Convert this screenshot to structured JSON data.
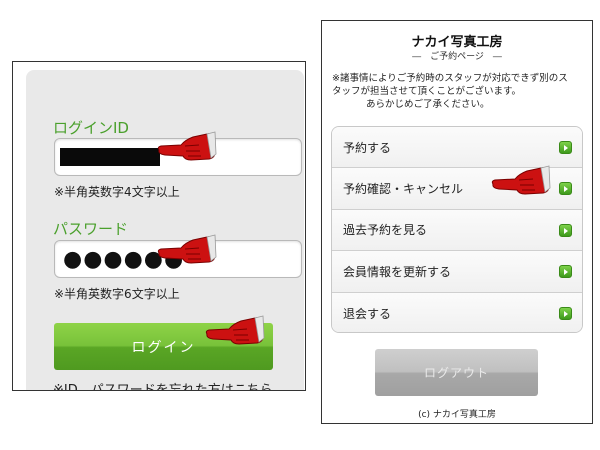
{
  "login_screen": {
    "id_label": "ログインID",
    "id_hint": "※半角英数字4文字以上",
    "password_label": "パスワード",
    "password_value": "●●●●●●",
    "password_hint": "※半角英数字6文字以上",
    "login_button": "ログイン",
    "forgot_link": "※ID、パスワードを忘れた方はこちら"
  },
  "reservation_screen": {
    "site_title": "ナカイ写真工房",
    "subtitle": "―　ご予約ページ　―",
    "notice_lines": [
      "※諸事情によりご予約時のスタッフが対応できず別のス",
      "タッフが担当させて頂くことがございます。",
      "あらかじめご了承ください。"
    ],
    "menu_items": [
      "予約する",
      "予約確認・キャンセル",
      "過去予約を見る",
      "会員情報を更新する",
      "退会する"
    ],
    "logout_button": "ログアウト",
    "footer": "(c) ナカイ写真工房"
  },
  "colors": {
    "label_green": "#4aa02c",
    "button_green": "#5aa625",
    "pointer_red": "#cc1111",
    "logout_gray": "#a8a8a8"
  },
  "icons": {
    "pointer": "pointing-hand-icon",
    "menu_go": "green-arrow-icon"
  }
}
